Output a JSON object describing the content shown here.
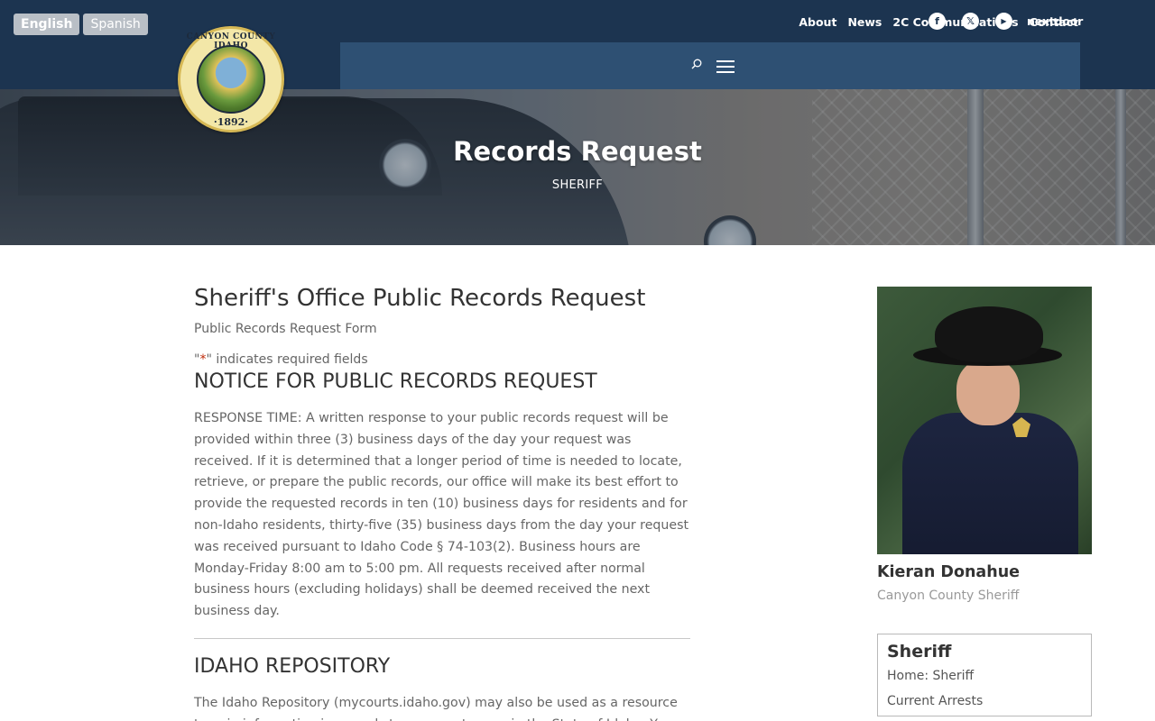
{
  "lang": {
    "english": "English",
    "spanish": "Spanish"
  },
  "seal": {
    "top_text": "CANYON COUNTY IDAHO",
    "year": "·1892·"
  },
  "topnav": {
    "items": [
      "About",
      "News",
      "2C Communications",
      "Contact"
    ]
  },
  "social": {
    "facebook": "f",
    "x": "𝕏",
    "youtube": "▶",
    "nextdoor": "nextdoor"
  },
  "hero": {
    "title": "Records Request",
    "subtitle": "SHERIFF"
  },
  "main": {
    "title": "Sheriff's Office Public Records Request",
    "form_title": "Public Records Request Form",
    "required_prefix": "\"",
    "required_star": "*",
    "required_suffix": "\" indicates required fields",
    "notice_heading": "NOTICE FOR PUBLIC RECORDS REQUEST",
    "notice_text": "RESPONSE TIME: A written response to your public records request will be provided within three (3) business days of the day your request was received. If it is determined that a longer period of time is needed to locate, retrieve, or prepare the public records, our office will make its best effort to provide the requested records in ten (10) business days for residents and for non-Idaho residents, thirty-five (35) business days from the day your request was received pursuant to Idaho Code § 74-103(2). Business hours are Monday-Friday 8:00 am to 5:00 pm. All requests received after normal business hours (excluding holidays) shall be deemed received the next business day.",
    "repo_heading": "IDAHO REPOSITORY",
    "repo_text": "The Idaho Repository (mycourts.idaho.gov) may also be used as a resource to gain information in regards to any court cases in the State of Idaho. You will"
  },
  "sidebar": {
    "name": "Kieran Donahue",
    "title": "Canyon County Sheriff",
    "box_title": "Sheriff",
    "links": [
      "Home: Sheriff",
      "Current Arrests"
    ]
  },
  "colors": {
    "header": "#1c3450",
    "nav_panel": "#2e5073",
    "required_star": "#c02b0a"
  }
}
